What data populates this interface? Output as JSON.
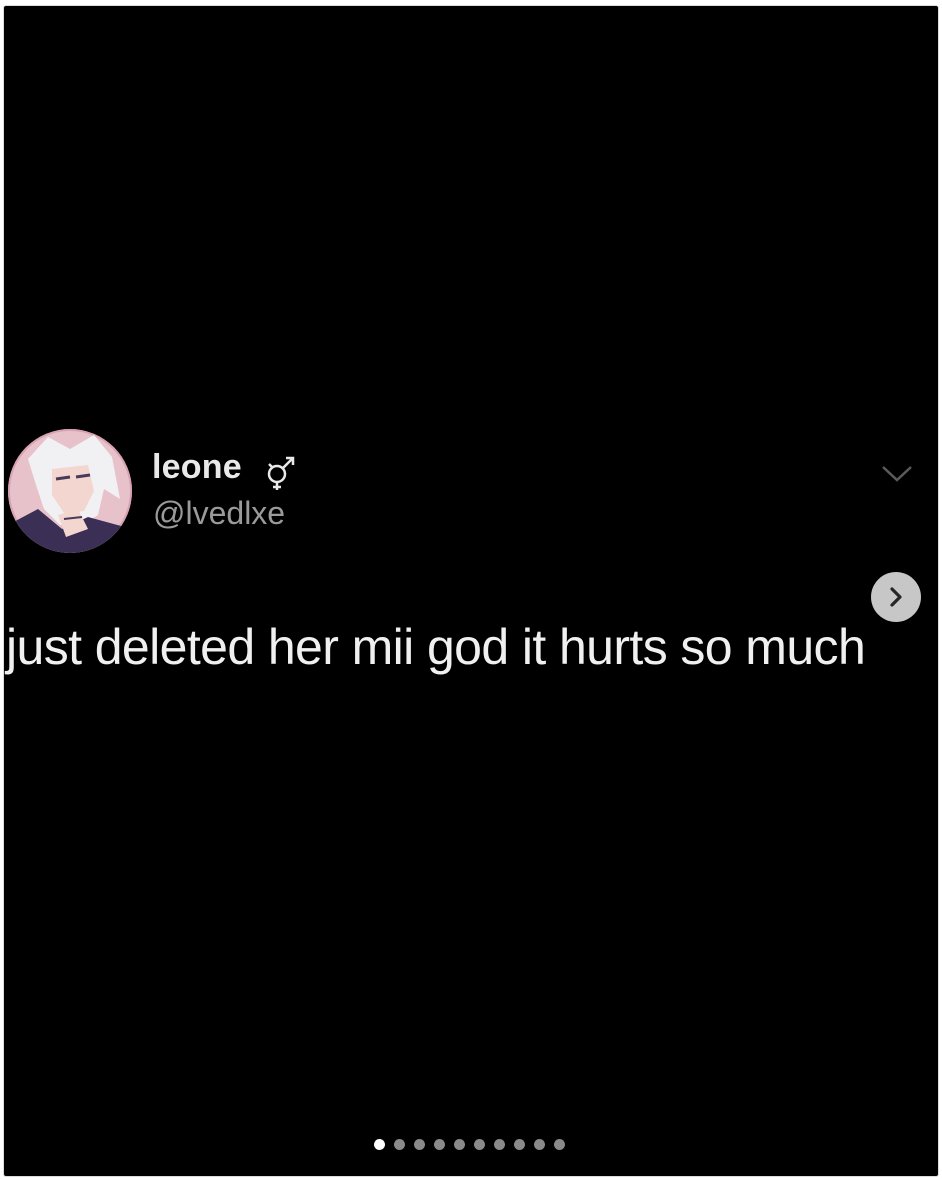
{
  "post": {
    "author": {
      "display_name": "leone",
      "name_symbol_icon": "intersex-symbol-icon",
      "handle": "@lvedlxe"
    },
    "text": "just deleted her mii god it hurts so much"
  },
  "carousel": {
    "total_slides": 10,
    "active_index": 0,
    "next_icon": "chevron-right-icon"
  },
  "colors": {
    "background": "#000000",
    "frame_border": "#dbdbdb",
    "active_dot": "#ffffff",
    "inactive_dot": "#8a8a8a"
  }
}
